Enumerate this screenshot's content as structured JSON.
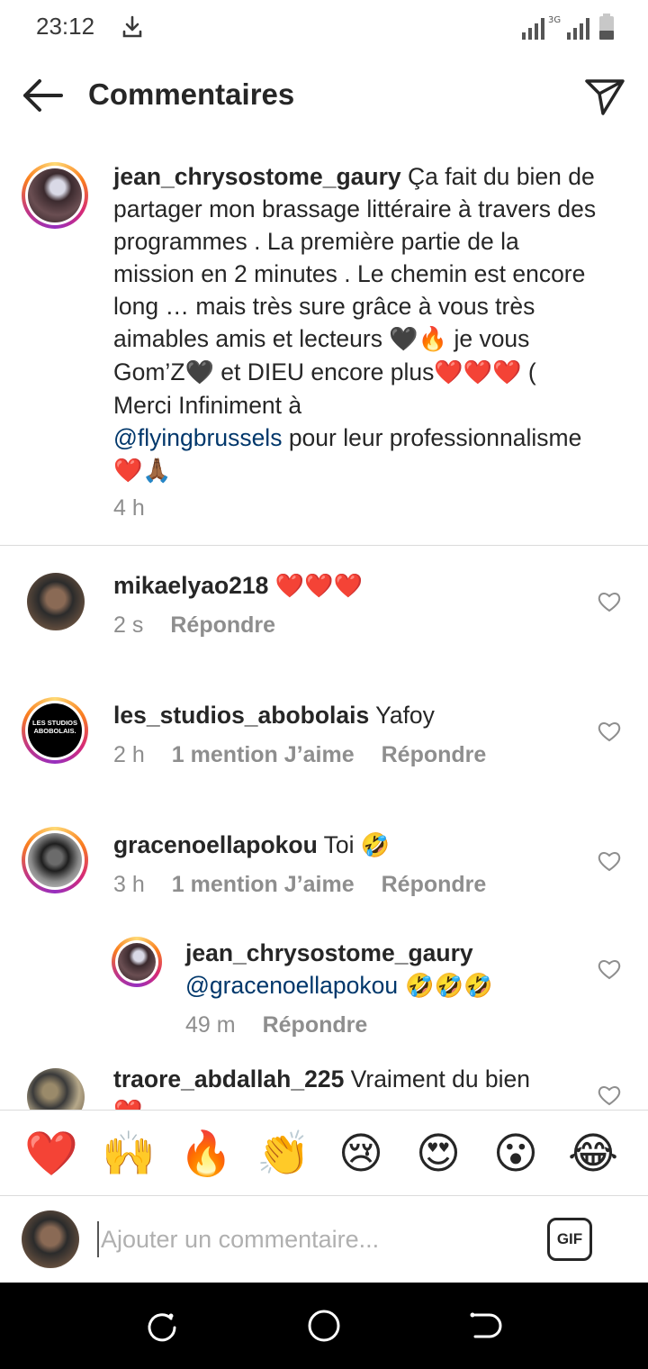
{
  "status": {
    "time": "23:12",
    "network": "3G"
  },
  "header": {
    "title": "Commentaires"
  },
  "caption": {
    "username": "jean_chrysostome_gaury",
    "text_1": " Ça fait du bien de partager mon brassage littéraire à travers des programmes . La première partie de la mission en 2 minutes . Le chemin est encore long … mais très sure grâce à vous très aimables amis et lecteurs ",
    "emoji_1": "🖤🔥",
    "text_2": " je vous Gom’Z",
    "emoji_2": "🖤",
    "text_3": " et DIEU encore plus",
    "emoji_3": "❤️❤️❤️",
    "text_4": " ( Merci Infiniment à ",
    "mention": "@flyingbrussels",
    "text_5": "  pour leur professionnalisme ",
    "emoji_4": "❤️🙏🏾",
    "time": "4 h"
  },
  "comments": [
    {
      "username": "mikaelyao218",
      "text": " ",
      "emoji": "❤️❤️❤️",
      "time": "2 s",
      "reply": "Répondre"
    },
    {
      "username": "les_studios_abobolais",
      "text": " Yafoy",
      "time": "2 h",
      "likes": "1 mention J’aime",
      "reply": "Répondre",
      "avatar_text": "LES STUDIOS ABOBOLAIS."
    },
    {
      "username": "gracenoellapokou",
      "text": " Toi ",
      "emoji": "🤣",
      "time": "3 h",
      "likes": "1 mention J’aime",
      "reply": "Répondre"
    },
    {
      "username": "jean_chrysostome_gaury",
      "mention": "@gracenoellapokou",
      "emoji": " 🤣🤣🤣",
      "time": "49 m",
      "reply": "Répondre"
    },
    {
      "username": "traore_abdallah_225",
      "text": " Vraiment du bien",
      "emoji": "❤️"
    }
  ],
  "reactions": [
    "❤️",
    "🙌",
    "🔥",
    "👏",
    "😢",
    "😍",
    "😮",
    "😂"
  ],
  "input": {
    "placeholder": "Ajouter un commentaire...",
    "gif_label": "GIF"
  },
  "colors": {
    "mention": "#00376b",
    "meta": "#8e8e8e",
    "heart": "#ed4956"
  }
}
